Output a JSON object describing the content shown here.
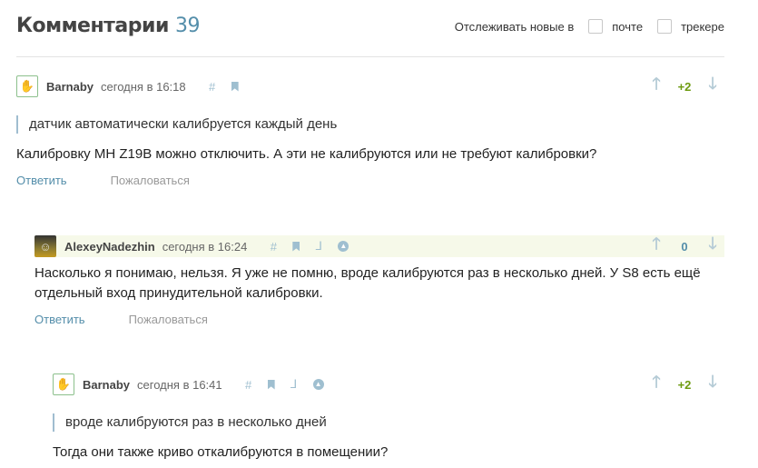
{
  "header": {
    "title": "Комментарии",
    "count": "39",
    "track_label": "Отслеживать новые в",
    "opt_mail": "почте",
    "opt_tracker": "трекере"
  },
  "colors": {
    "accent": "#548eaa",
    "positive": "#6c9a0f",
    "highlight": "#f6f9e9"
  },
  "comments": [
    {
      "user": "Barnaby",
      "time": "сегодня в 16:18",
      "score": "+2",
      "quote": "датчик автоматически калибруется каждый день",
      "text": "Калибровку MH Z19B можно отключить. А эти не калибруются или не требуют калибровки?",
      "reply": "Ответить",
      "report": "Пожаловаться"
    },
    {
      "user": "AlexeyNadezhin",
      "time": "сегодня в 16:24",
      "score": "0",
      "text": "Насколько я понимаю, нельзя. Я уже не помню, вроде калибруются раз в несколько дней. У S8 есть ещё отдельный вход принудительной калибровки.",
      "reply": "Ответить",
      "report": "Пожаловаться"
    },
    {
      "user": "Barnaby",
      "time": "сегодня в 16:41",
      "score": "+2",
      "quote": "вроде калибруются раз в несколько дней",
      "text": "Тогда они также криво откалибруются в помещении?"
    }
  ]
}
